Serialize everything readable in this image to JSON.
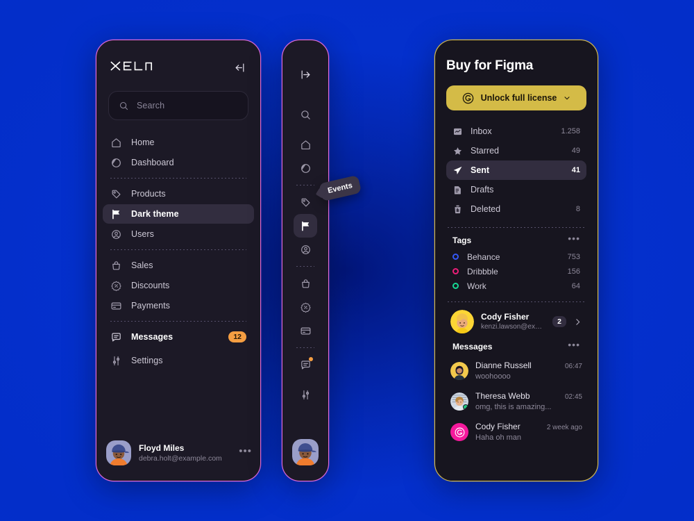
{
  "theme": {
    "background_blue": "#0430cd",
    "panel_bg": "#1c1926",
    "panel_bg_dark": "#17151f",
    "border_pink": "#e46bd8",
    "border_gold": "#d9bd4e",
    "accent_gold": "#d4bb47",
    "accent_orange": "#f59e42",
    "active_row": "#322d3f"
  },
  "sidebar": {
    "logo": "XELA",
    "collapse_icon": "collapse-left-icon",
    "search": {
      "placeholder": "Search",
      "icon": "search-icon",
      "value": ""
    },
    "groups": [
      {
        "items": [
          {
            "label": "Home",
            "icon": "home-icon",
            "active": false,
            "badge": ""
          },
          {
            "label": "Dashboard",
            "icon": "pie-chart-icon",
            "active": false,
            "badge": ""
          }
        ]
      },
      {
        "items": [
          {
            "label": "Products",
            "icon": "tag-icon",
            "active": false,
            "badge": ""
          },
          {
            "label": "Dark theme",
            "icon": "flag-icon",
            "active": true,
            "badge": ""
          },
          {
            "label": "Users",
            "icon": "user-circle-icon",
            "active": false,
            "badge": ""
          }
        ]
      },
      {
        "items": [
          {
            "label": "Sales",
            "icon": "bag-icon",
            "active": false,
            "badge": ""
          },
          {
            "label": "Discounts",
            "icon": "discount-icon",
            "active": false,
            "badge": ""
          },
          {
            "label": "Payments",
            "icon": "credit-card-icon",
            "active": false,
            "badge": ""
          }
        ]
      },
      {
        "items": [
          {
            "label": "Messages",
            "icon": "message-icon",
            "active": false,
            "bold": true,
            "badge": "12"
          },
          {
            "label": "Settings",
            "icon": "sliders-icon",
            "active": false,
            "badge": ""
          }
        ]
      }
    ],
    "profile": {
      "name": "Floyd Miles",
      "email": "debra.holt@example.com",
      "avatar": "avatar-floyd-miles",
      "more_icon": "more-horizontal-icon"
    }
  },
  "rail": {
    "expand_icon": "expand-right-icon",
    "items": [
      {
        "icon": "search-icon",
        "active": false,
        "dot": false
      },
      {
        "icon": "home-icon",
        "active": false,
        "dot": false
      },
      {
        "icon": "pie-chart-icon",
        "active": false,
        "dot": false
      },
      {
        "icon": "tag-icon",
        "active": false,
        "dot": false
      },
      {
        "icon": "flag-icon",
        "active": true,
        "dot": false
      },
      {
        "icon": "user-circle-icon",
        "active": false,
        "dot": false
      },
      {
        "icon": "bag-icon",
        "active": false,
        "dot": false
      },
      {
        "icon": "discount-icon",
        "active": false,
        "dot": false
      },
      {
        "icon": "credit-card-icon",
        "active": false,
        "dot": false
      },
      {
        "icon": "message-icon",
        "active": false,
        "dot": true
      },
      {
        "icon": "sliders-icon",
        "active": false,
        "dot": false
      }
    ],
    "tooltip": "Events",
    "avatar": "avatar-floyd-miles"
  },
  "mail": {
    "title": "Buy for Figma",
    "license_button": {
      "label": "Unlock full license",
      "brand_icon": "gumroad-g-icon",
      "chevron_icon": "chevron-down-icon"
    },
    "folders": [
      {
        "label": "Inbox",
        "icon": "inbox-icon",
        "count": "1.258",
        "active": false
      },
      {
        "label": "Starred",
        "icon": "star-icon",
        "count": "49",
        "active": false
      },
      {
        "label": "Sent",
        "icon": "send-icon",
        "count": "41",
        "active": true
      },
      {
        "label": "Drafts",
        "icon": "document-icon",
        "count": "",
        "active": false
      },
      {
        "label": "Deleted",
        "icon": "trash-icon",
        "count": "8",
        "active": false
      }
    ],
    "tags_section": {
      "title": "Tags",
      "more_icon": "more-horizontal-icon",
      "tags": [
        {
          "label": "Behance",
          "count": "753",
          "color": "#3558f6"
        },
        {
          "label": "Dribbble",
          "count": "156",
          "color": "#ed1e79"
        },
        {
          "label": "Work",
          "count": "64",
          "color": "#16d994"
        }
      ]
    },
    "contact": {
      "name": "Cody Fisher",
      "email": "kenzi.lawson@exampl...",
      "badge": "2",
      "avatar": "avatar-cody-fisher",
      "chevron_icon": "chevron-right-icon"
    },
    "messages_section": {
      "title": "Messages",
      "more_icon": "more-horizontal-icon",
      "messages": [
        {
          "name": "Dianne Russell",
          "preview": "woohoooo",
          "time": "06:47",
          "avatar": "avatar-dianne-russell",
          "online": false
        },
        {
          "name": "Theresa Webb",
          "preview": "omg, this is amazing...",
          "time": "02:45",
          "avatar": "avatar-theresa-webb",
          "online": true
        },
        {
          "name": "Cody Fisher",
          "preview": "Haha oh man",
          "time": "2 week ago",
          "avatar": "avatar-cody-logo",
          "online": false
        }
      ]
    }
  }
}
